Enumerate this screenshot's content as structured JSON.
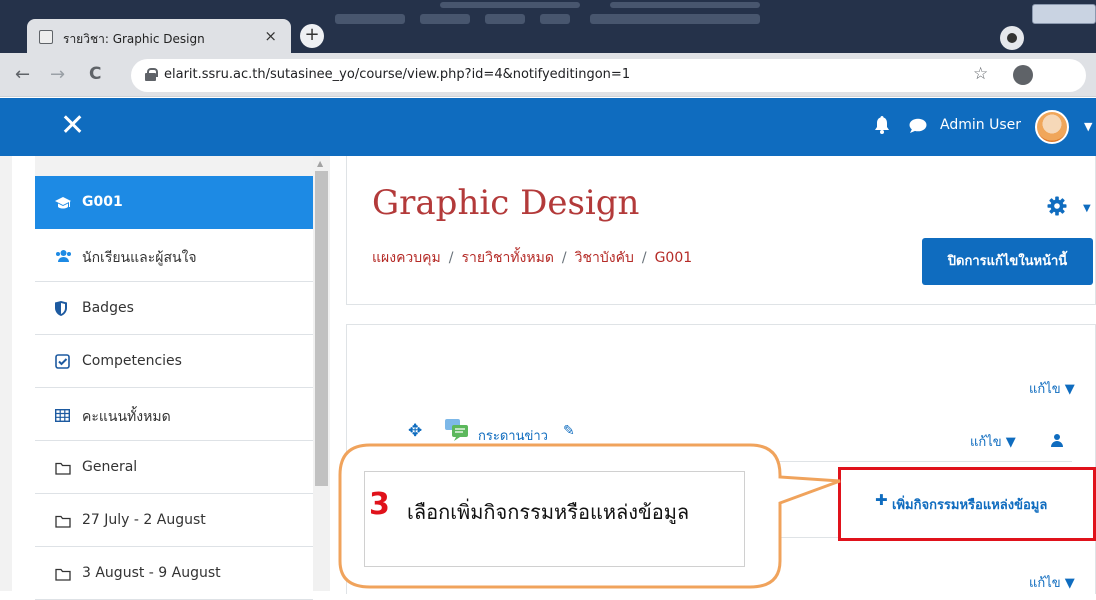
{
  "browser": {
    "tab_title": "รายวิชา: Graphic Design",
    "tab_close": "×",
    "new_tab": "+",
    "url": "elarit.ssru.ac.th/sutasinee_yo/course/view.php?id=4&notifyeditingon=1",
    "nav": {
      "back": "←",
      "forward": "→",
      "reload": "C"
    },
    "bookmark_star": "☆"
  },
  "navbar": {
    "close_glyph": "✕",
    "user_name": "Admin User",
    "caret": "▼"
  },
  "sidebar": {
    "items": [
      {
        "label": "G001",
        "icon": "graduation-cap-icon",
        "active": true
      },
      {
        "label": "นักเรียนและผู้สนใจ",
        "icon": "users-icon"
      },
      {
        "label": "Badges",
        "icon": "shield-icon"
      },
      {
        "label": "Competencies",
        "icon": "checkbox-icon"
      },
      {
        "label": "คะแนนทั้งหมด",
        "icon": "table-icon"
      },
      {
        "label": "General",
        "icon": "folder-icon"
      },
      {
        "label": "27 July - 2 August",
        "icon": "folder-icon"
      },
      {
        "label": "3 August - 9 August",
        "icon": "folder-icon"
      }
    ]
  },
  "course": {
    "title": "Graphic Design",
    "breadcrumb": [
      "แผงควบคุม",
      "รายวิชาทั้งหมด",
      "วิชาบังคับ",
      "G001"
    ],
    "breadcrumb_sep": "/",
    "edit_off_button": "ปิดการแก้ไขในหน้านี้"
  },
  "content": {
    "edit_label": "แก้ไข ▼",
    "forum_link": "กระดานข่าว",
    "add_activity": "เพิ่มกิจกรรมหรือแหล่งข้อมูล"
  },
  "callout": {
    "step_number": "3",
    "text": "เลือกเพิ่มกิจกรรมหรือแหล่งข้อมูล"
  },
  "colors": {
    "brand": "#0f6cbf",
    "active_item": "#1d8ae4",
    "course_title": "#b33a3a",
    "highlight_box": "#e0121b",
    "callout_border": "#f0a35c"
  }
}
